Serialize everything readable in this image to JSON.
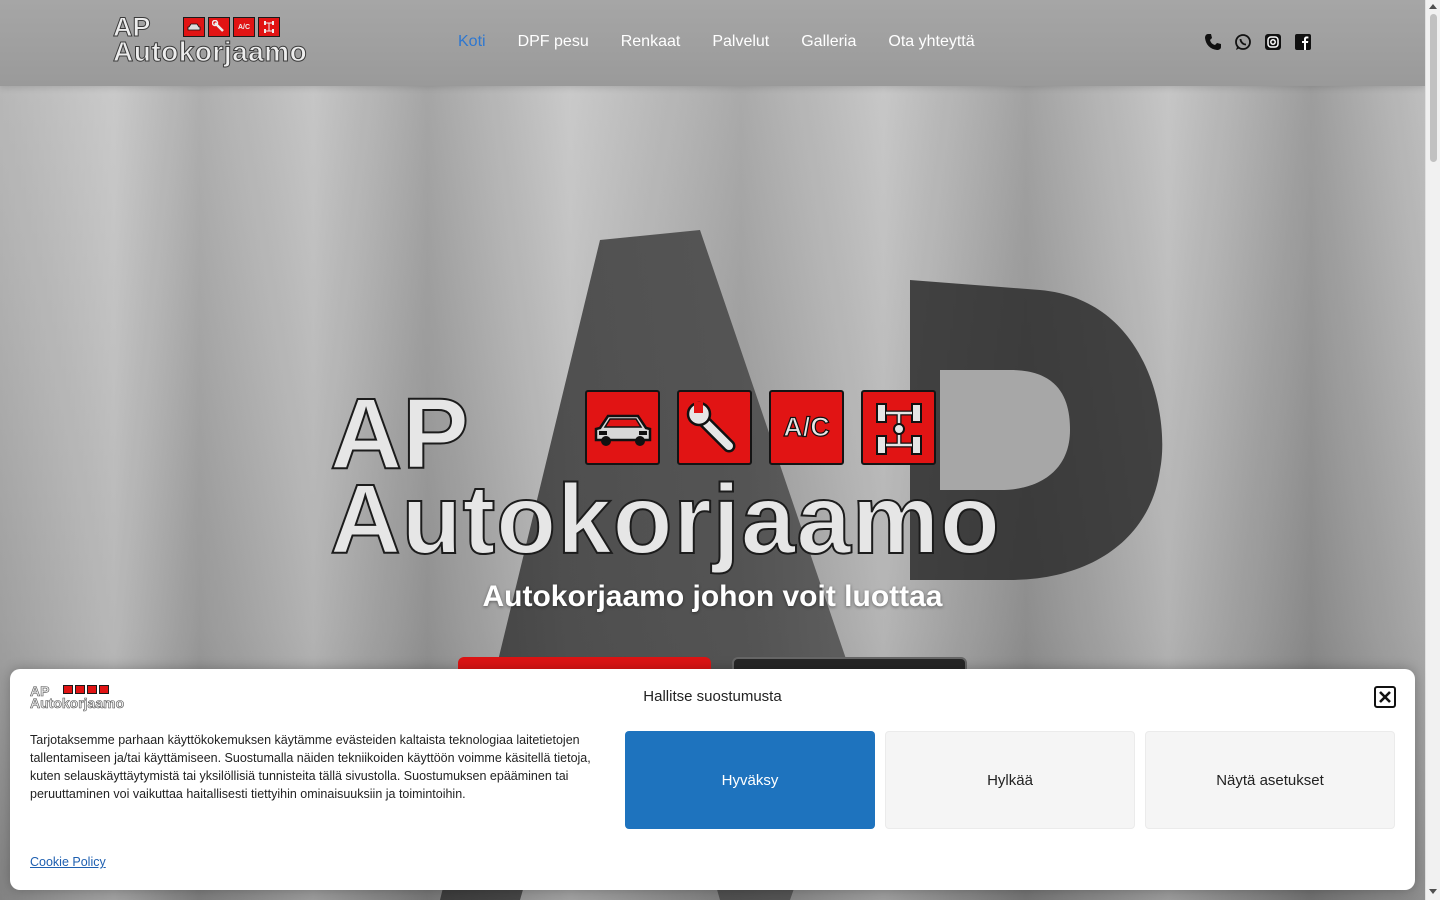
{
  "brand": {
    "line1": "AP",
    "line2": "Autokorjaamo",
    "icon_names": [
      "car-icon",
      "wrench-icon",
      "ac-icon",
      "axle-icon"
    ],
    "ac_label": "A/C",
    "accent": "#e11414"
  },
  "nav": {
    "items": [
      {
        "label": "Koti",
        "active": true
      },
      {
        "label": "DPF pesu"
      },
      {
        "label": "Renkaat"
      },
      {
        "label": "Palvelut"
      },
      {
        "label": "Galleria"
      },
      {
        "label": "Ota yhteyttä"
      }
    ],
    "active_color": "#2e77d0"
  },
  "social": [
    "phone-icon",
    "whatsapp-icon",
    "instagram-icon",
    "facebook-icon"
  ],
  "hero": {
    "tagline": "Autokorjaamo johon voit luottaa"
  },
  "cookie": {
    "title": "Hallitse suostumusta",
    "text": "Tarjotaksemme parhaan käyttökokemuksen käytämme evästeiden kaltaista teknologiaa laitetietojen tallentamiseen ja/tai käyttämiseen. Suostumalla näiden tekniikoiden käyttöön voimme käsitellä tietoja, kuten selauskäyttäytymistä tai yksilöllisiä tunnisteita tällä sivustolla. Suostumuksen epääminen tai peruuttaminen voi vaikuttaa haitallisesti tiettyihin ominaisuuksiin ja toimintoihin.",
    "accept": "Hyväksy",
    "deny": "Hylkää",
    "preferences": "Näytä asetukset",
    "policy_link": "Cookie Policy",
    "accept_color": "#1e73be"
  }
}
